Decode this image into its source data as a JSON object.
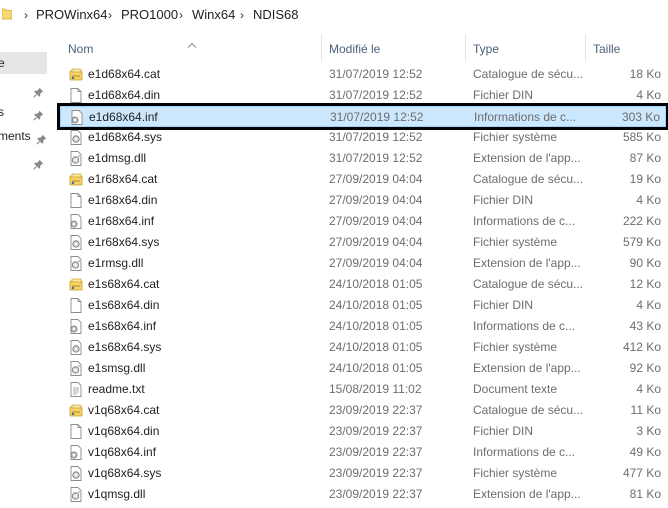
{
  "breadcrumb": [
    "PROWinx64",
    "PRO1000",
    "Winx64",
    "NDIS68"
  ],
  "breadcrumb_separator": "›",
  "nav": {
    "items": [
      {
        "label": "e",
        "pinned": false,
        "selected": true
      },
      {
        "label": "",
        "pinned": true,
        "selected": false
      },
      {
        "label": "s",
        "pinned": true,
        "selected": false
      },
      {
        "label": "ments",
        "pinned": true,
        "selected": false
      },
      {
        "label": "",
        "pinned": true,
        "selected": false
      }
    ]
  },
  "columns": {
    "name": "Nom",
    "date": "Modifié le",
    "type": "Type",
    "size": "Taille"
  },
  "sort_column": "name",
  "selected_index": 2,
  "files": [
    {
      "name": "e1d68x64.cat",
      "date": "31/07/2019 12:52",
      "type": "Catalogue de sécu...",
      "size": "18 Ko",
      "icon": "catalog-icon"
    },
    {
      "name": "e1d68x64.din",
      "date": "31/07/2019 12:52",
      "type": "Fichier DIN",
      "size": "4 Ko",
      "icon": "file-icon"
    },
    {
      "name": "e1d68x64.inf",
      "date": "31/07/2019 12:52",
      "type": "Informations de c...",
      "size": "303 Ko",
      "icon": "setup-info-icon"
    },
    {
      "name": "e1d68x64.sys",
      "date": "31/07/2019 12:52",
      "type": "Fichier système",
      "size": "585 Ko",
      "icon": "system-file-icon"
    },
    {
      "name": "e1dmsg.dll",
      "date": "31/07/2019 12:52",
      "type": "Extension de l'app...",
      "size": "87 Ko",
      "icon": "dll-icon"
    },
    {
      "name": "e1r68x64.cat",
      "date": "27/09/2019 04:04",
      "type": "Catalogue de sécu...",
      "size": "19 Ko",
      "icon": "catalog-icon"
    },
    {
      "name": "e1r68x64.din",
      "date": "27/09/2019 04:04",
      "type": "Fichier DIN",
      "size": "4 Ko",
      "icon": "file-icon"
    },
    {
      "name": "e1r68x64.inf",
      "date": "27/09/2019 04:04",
      "type": "Informations de c...",
      "size": "222 Ko",
      "icon": "setup-info-icon"
    },
    {
      "name": "e1r68x64.sys",
      "date": "27/09/2019 04:04",
      "type": "Fichier système",
      "size": "579 Ko",
      "icon": "system-file-icon"
    },
    {
      "name": "e1rmsg.dll",
      "date": "27/09/2019 04:04",
      "type": "Extension de l'app...",
      "size": "90 Ko",
      "icon": "dll-icon"
    },
    {
      "name": "e1s68x64.cat",
      "date": "24/10/2018 01:05",
      "type": "Catalogue de sécu...",
      "size": "12 Ko",
      "icon": "catalog-icon"
    },
    {
      "name": "e1s68x64.din",
      "date": "24/10/2018 01:05",
      "type": "Fichier DIN",
      "size": "4 Ko",
      "icon": "file-icon"
    },
    {
      "name": "e1s68x64.inf",
      "date": "24/10/2018 01:05",
      "type": "Informations de c...",
      "size": "43 Ko",
      "icon": "setup-info-icon"
    },
    {
      "name": "e1s68x64.sys",
      "date": "24/10/2018 01:05",
      "type": "Fichier système",
      "size": "412 Ko",
      "icon": "system-file-icon"
    },
    {
      "name": "e1smsg.dll",
      "date": "24/10/2018 01:05",
      "type": "Extension de l'app...",
      "size": "92 Ko",
      "icon": "dll-icon"
    },
    {
      "name": "readme.txt",
      "date": "15/08/2019 11:02",
      "type": "Document texte",
      "size": "4 Ko",
      "icon": "text-file-icon"
    },
    {
      "name": "v1q68x64.cat",
      "date": "23/09/2019 22:37",
      "type": "Catalogue de sécu...",
      "size": "11 Ko",
      "icon": "catalog-icon"
    },
    {
      "name": "v1q68x64.din",
      "date": "23/09/2019 22:37",
      "type": "Fichier DIN",
      "size": "3 Ko",
      "icon": "file-icon"
    },
    {
      "name": "v1q68x64.inf",
      "date": "23/09/2019 22:37",
      "type": "Informations de c...",
      "size": "49 Ko",
      "icon": "setup-info-icon"
    },
    {
      "name": "v1q68x64.sys",
      "date": "23/09/2019 22:37",
      "type": "Fichier système",
      "size": "477 Ko",
      "icon": "system-file-icon"
    },
    {
      "name": "v1qmsg.dll",
      "date": "23/09/2019 22:37",
      "type": "Extension de l'app...",
      "size": "81 Ko",
      "icon": "dll-icon"
    }
  ],
  "colors": {
    "selection_fill": "#cce8ff",
    "selection_border": "#99d1ff",
    "highlight_box": "#000000",
    "header_text": "#4c607a",
    "secondary_text": "#6d6d6d"
  }
}
